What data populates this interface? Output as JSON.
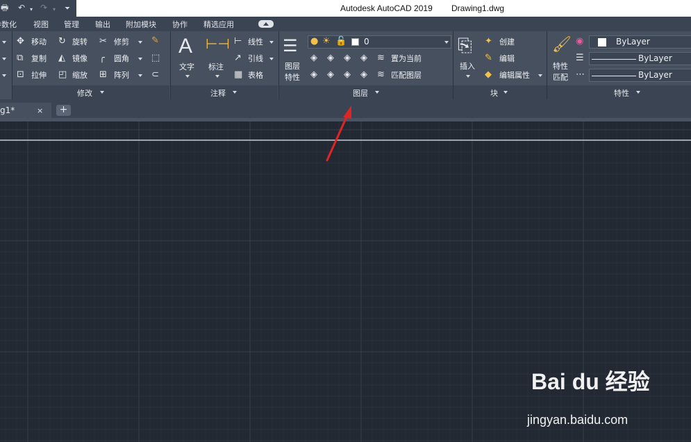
{
  "titlebar": {
    "app_name": "Autodesk AutoCAD 2019",
    "file_name": "Drawing1.dwg"
  },
  "menu": {
    "tabs": [
      "参数化",
      "视图",
      "管理",
      "输出",
      "附加模块",
      "协作",
      "精选应用"
    ]
  },
  "ribbon": {
    "modify": {
      "move": "移动",
      "rotate": "旋转",
      "trim": "修剪",
      "copy": "复制",
      "mirror": "镜像",
      "fillet": "圆角",
      "stretch": "拉伸",
      "scale": "缩放",
      "array": "阵列",
      "footer": "修改"
    },
    "annotation": {
      "text": "文字",
      "dimension": "标注",
      "linear": "线性",
      "leader": "引线",
      "table": "表格",
      "footer": "注释"
    },
    "layers": {
      "properties_line1": "图层",
      "properties_line2": "特性",
      "current_layer": "0",
      "set_current": "置为当前",
      "match_layer": "匹配图层",
      "footer": "图层"
    },
    "block": {
      "insert": "插入",
      "create": "创建",
      "edit": "编辑",
      "edit_attributes": "编辑属性",
      "footer": "块"
    },
    "properties": {
      "match_line1": "特性",
      "match_line2": "匹配",
      "color": "ByLayer",
      "lineweight": "ByLayer",
      "linetype": "ByLayer",
      "footer": "特性"
    }
  },
  "filetabs": {
    "active_tab": "g1*",
    "close_glyph": "×",
    "new_tab_glyph": "+"
  },
  "watermark": {
    "brand": "Bai du 经验",
    "url": "jingyan.baidu.com"
  },
  "colors": {
    "canvas_bg": "#222933",
    "ribbon_bg": "#46505f",
    "arrow": "#e02424"
  }
}
